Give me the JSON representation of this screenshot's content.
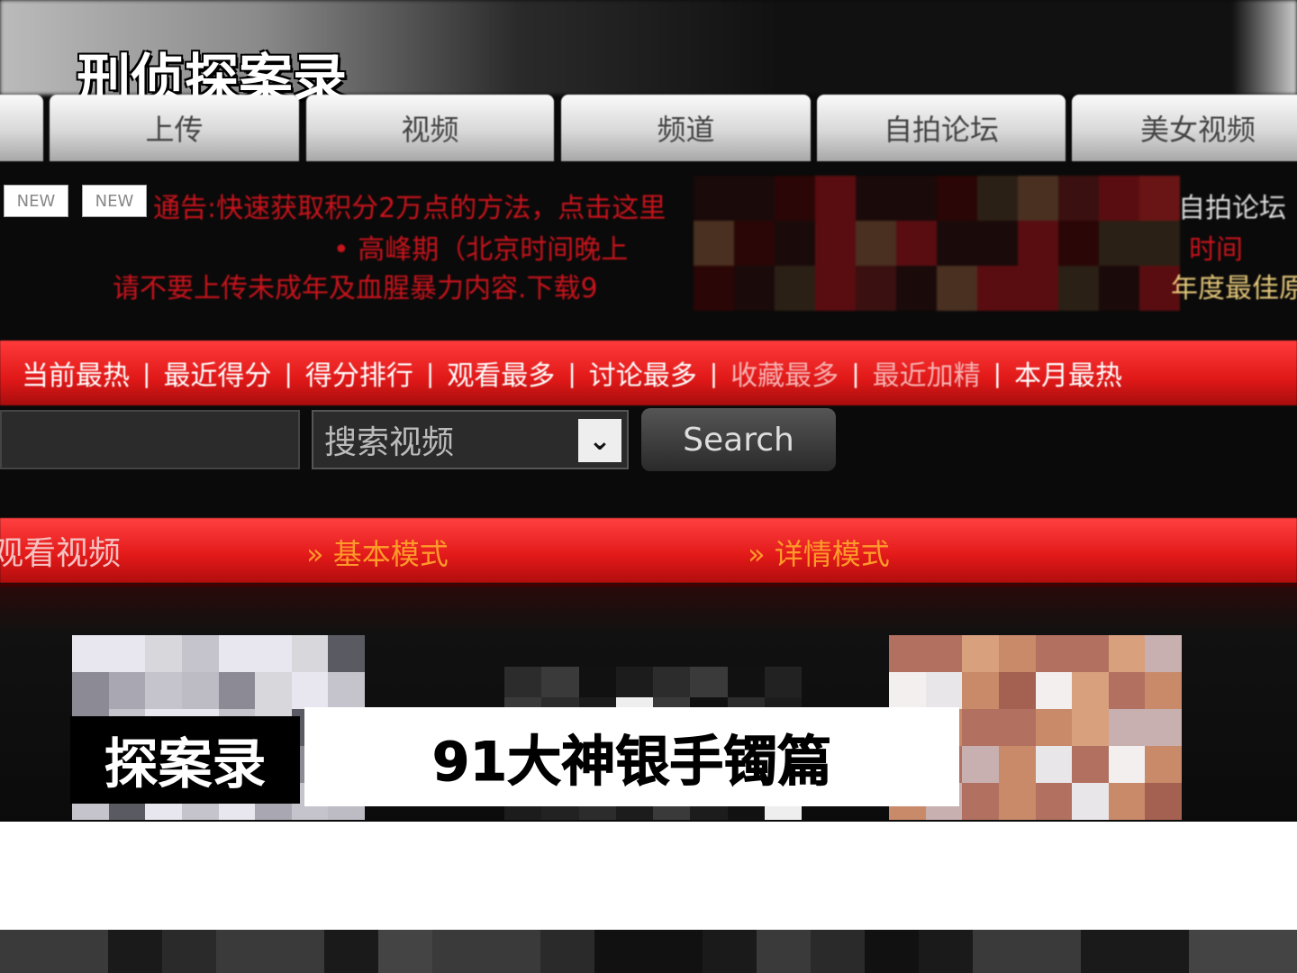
{
  "overlay": {
    "show_title": "刑侦探案录",
    "caption_label": "探案录",
    "caption_title": "91大神银手镯篇"
  },
  "tabs": [
    "上传",
    "视频",
    "频道",
    "自拍论坛",
    "美女视频"
  ],
  "announcement": {
    "badges": [
      "NEW",
      "NEW"
    ],
    "line1": "通告:快速获取积分2万点的方法，点击这里",
    "line1_tail": "自拍论坛",
    "line2": "• 高峰期（北京时间晚上",
    "line2_tail": "时间",
    "line3": "请不要上传未成年及血腥暴力内容.下载9",
    "line3_tail": "年度最佳原"
  },
  "nav": [
    "当前最热",
    "最近得分",
    "得分排行",
    "观看最多",
    "讨论最多",
    "收藏最多",
    "最近加精",
    "本月最热"
  ],
  "search": {
    "select_value": "搜索视频",
    "button": "Search"
  },
  "section": {
    "title": "观看视频",
    "mode_basic": "» 基本模式",
    "mode_detail": "» 详情模式"
  },
  "colors": {
    "accent_red": "#e01818",
    "announce_red": "#c8141c",
    "mode_orange": "#ff9a2a"
  }
}
